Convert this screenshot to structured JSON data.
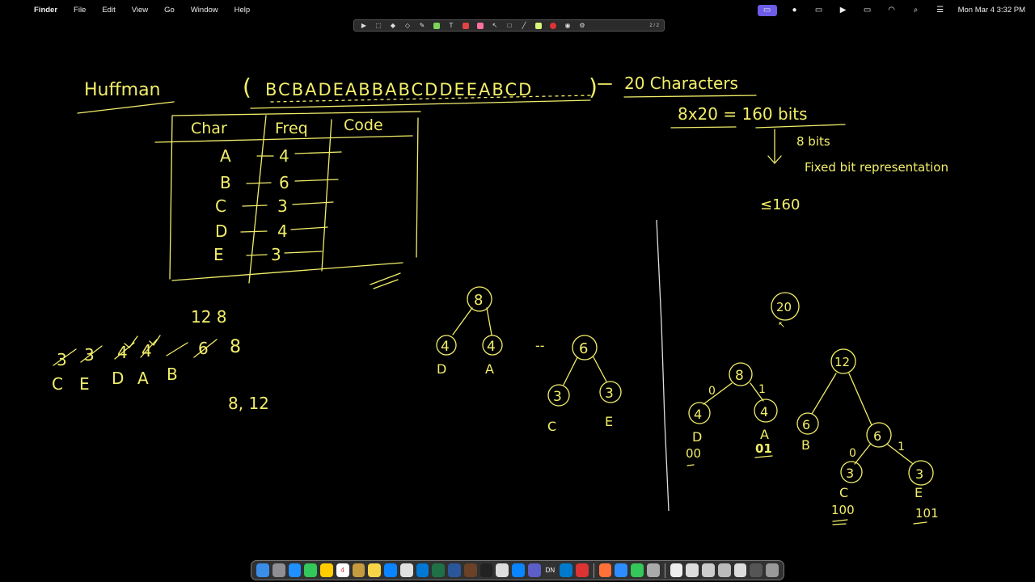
{
  "menubar": {
    "apple_icon": "apple-icon",
    "app_name": "Finder",
    "items": [
      "File",
      "Edit",
      "View",
      "Go",
      "Window",
      "Help"
    ],
    "clock": "Mon Mar 4  3:32 PM",
    "status_icons": [
      "screen-share-icon",
      "record-icon",
      "display-icon",
      "play-icon",
      "battery-icon",
      "wifi-icon",
      "search-icon",
      "control-center-icon"
    ]
  },
  "toolbar": {
    "tools": [
      "pointer-icon",
      "select-icon",
      "eraser-icon",
      "shape-icon",
      "pen-icon",
      "highlighter-icon",
      "text-icon",
      "color-icon",
      "marker-icon",
      "cursor-icon",
      "rectangle-icon",
      "line-icon",
      "fill-icon",
      "record-icon",
      "camera-icon",
      "settings-icon"
    ],
    "page_indicator": "2 / 2"
  },
  "whiteboard": {
    "title": "Huffman",
    "sequence": "BCBADEABBABCDDEEABCD",
    "char_count_label": "20 Characters",
    "fixed_calc": "8x20 = 160 bits",
    "bits_note": "8 bits",
    "fixed_note": "Fixed bit representation",
    "less_than": "≤160",
    "table": {
      "headers": [
        "Char",
        "Freq",
        "Code"
      ],
      "rows": [
        {
          "char": "A",
          "freq": "4"
        },
        {
          "char": "B",
          "freq": "6"
        },
        {
          "char": "C",
          "freq": "3"
        },
        {
          "char": "D",
          "freq": "4"
        },
        {
          "char": "E",
          "freq": "3"
        }
      ]
    },
    "queue_top": "12  8",
    "queue_values": [
      "3",
      "3",
      "4",
      "4",
      "6",
      "8"
    ],
    "queue_chars": [
      "C",
      "E",
      "D",
      "A",
      "B"
    ],
    "queue_bottom": "8, 12",
    "tree1": {
      "root": "8",
      "left": "4",
      "right": "4",
      "left_label": "D",
      "right_label": "A"
    },
    "tree2_prefix": "--",
    "tree2": {
      "root": "6",
      "left": "3",
      "right": "3",
      "left_label": "C",
      "right_label": "E"
    },
    "final_tree": {
      "root": "20",
      "n8": "8",
      "n4d": "4",
      "n4a": "4",
      "d_label": "D",
      "a_label": "A",
      "d_code": "00",
      "a_code": "01",
      "edge0": "0",
      "edge1": "1",
      "n12": "12",
      "n6b": "6",
      "b_label": "B",
      "n6": "6",
      "n3c": "3",
      "n3e": "3",
      "edge0b": "0",
      "edge1b": "1",
      "c_label": "C",
      "e_label": "E",
      "c_code": "100",
      "e_code": "101"
    }
  },
  "dock": {
    "apps": [
      "finder-icon",
      "launchpad-icon",
      "safari-icon",
      "messages-icon",
      "photos-icon",
      "calendar-icon",
      "files-icon",
      "notes-icon",
      "appstore-icon",
      "chrome-icon",
      "outlook-icon",
      "excel-icon",
      "word-icon",
      "games-icon",
      "terminal-icon",
      "chrome2-icon",
      "bluetooth-icon",
      "teams-icon",
      "dn-icon",
      "vscode-icon",
      "acrobat-icon",
      "firefox-icon",
      "zoom-icon",
      "facetime-icon",
      "preview-icon"
    ],
    "recent": [
      "doc1-icon",
      "doc2-icon",
      "doc3-icon",
      "doc4-icon",
      "doc5-icon",
      "doc6-icon",
      "trash-icon"
    ],
    "calendar_day": "4"
  }
}
